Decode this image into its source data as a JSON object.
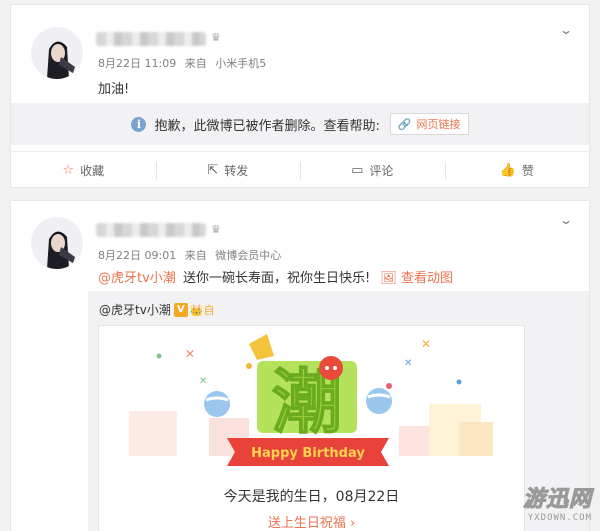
{
  "post1": {
    "meta_date": "8月22日 11:09",
    "meta_from": "来自",
    "meta_device": "小米手机5",
    "text": "加油!",
    "deleted_notice": "抱歉，此微博已被作者删除。查看帮助:",
    "webpage_link": "网页链接"
  },
  "post2": {
    "meta_date": "8月22日 09:01",
    "meta_from": "来自",
    "meta_device": "微博会员中心",
    "mention": "@虎牙tv小潮",
    "text": "送你一碗长寿面，祝你生日快乐!",
    "view_animation": "查看动图",
    "repost": {
      "author": "@虎牙tv小潮",
      "v_badge": "V",
      "vip_label": "自",
      "card_title": "潮",
      "card_banner": "Happy Birthday",
      "card_message": "今天是我的生日，08月22日",
      "card_action": "送上生日祝福 ›"
    }
  },
  "actions": {
    "favorite": "收藏",
    "repost": "转发",
    "comment": "评论",
    "like": "赞"
  },
  "watermark": {
    "big": "游迅网",
    "small": "YXDOWN.COM"
  },
  "colors": {
    "link_orange": "#eb7350",
    "bg_gray": "#f2f2f5",
    "crown_yellow": "#f5a623"
  }
}
